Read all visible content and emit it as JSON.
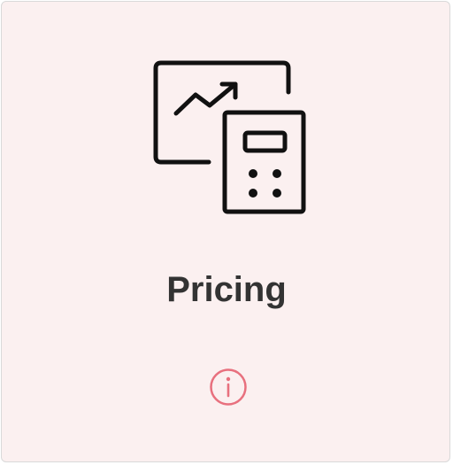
{
  "card": {
    "title": "Pricing",
    "icon": "pricing-chart-calculator-icon",
    "info_icon": "info-icon"
  },
  "colors": {
    "card_background": "#fbf0f0",
    "title": "#333333",
    "icon_stroke": "#111111",
    "info_accent": "#e8707e"
  }
}
